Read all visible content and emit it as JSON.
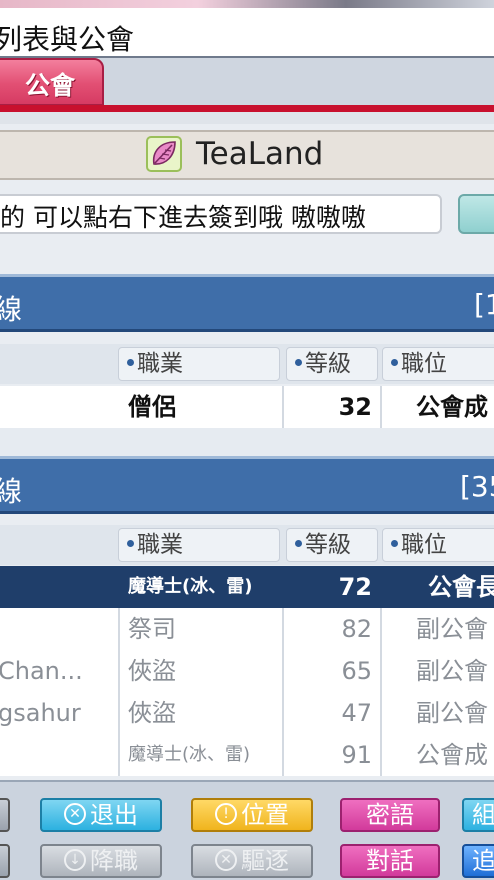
{
  "window": {
    "title": "列表與公會"
  },
  "tabs": [
    {
      "label": "公會",
      "active": true
    }
  ],
  "guild": {
    "name": "TeaLand",
    "notice": "的 可以點右下進去簽到哦 嗷嗷嗷"
  },
  "columns": {
    "job": "職業",
    "level": "等級",
    "position": "職位"
  },
  "online_panel": {
    "title": "線",
    "count": "[1",
    "rows": [
      {
        "name": "",
        "job": "僧侶",
        "level": "32",
        "position": "公會成"
      }
    ]
  },
  "offline_panel": {
    "title": "線",
    "count": "[35",
    "rows": [
      {
        "name": "",
        "job": "魔導士(冰、雷)",
        "level": "72",
        "position": "公會長",
        "selected": true
      },
      {
        "name": "",
        "job": "祭司",
        "level": "82",
        "position": "副公會"
      },
      {
        "name": "Chan...",
        "job": "俠盜",
        "level": "65",
        "position": "副公會"
      },
      {
        "name": "gsahur",
        "job": "俠盜",
        "level": "47",
        "position": "副公會"
      },
      {
        "name": "",
        "job": "魔導士(冰、雷)",
        "level": "91",
        "position": "公會成"
      }
    ]
  },
  "buttons": {
    "quit": "退出",
    "location": "位置",
    "whisper": "密語",
    "party": "組",
    "demote": "降職",
    "expel": "驅逐",
    "chat": "對話",
    "edge_blue": "追"
  },
  "colors": {
    "accent_red": "#c8102e",
    "tab_pink": "#e24f73",
    "panel_blue": "#3f6ea9",
    "selected_row": "#1f3e6a"
  }
}
